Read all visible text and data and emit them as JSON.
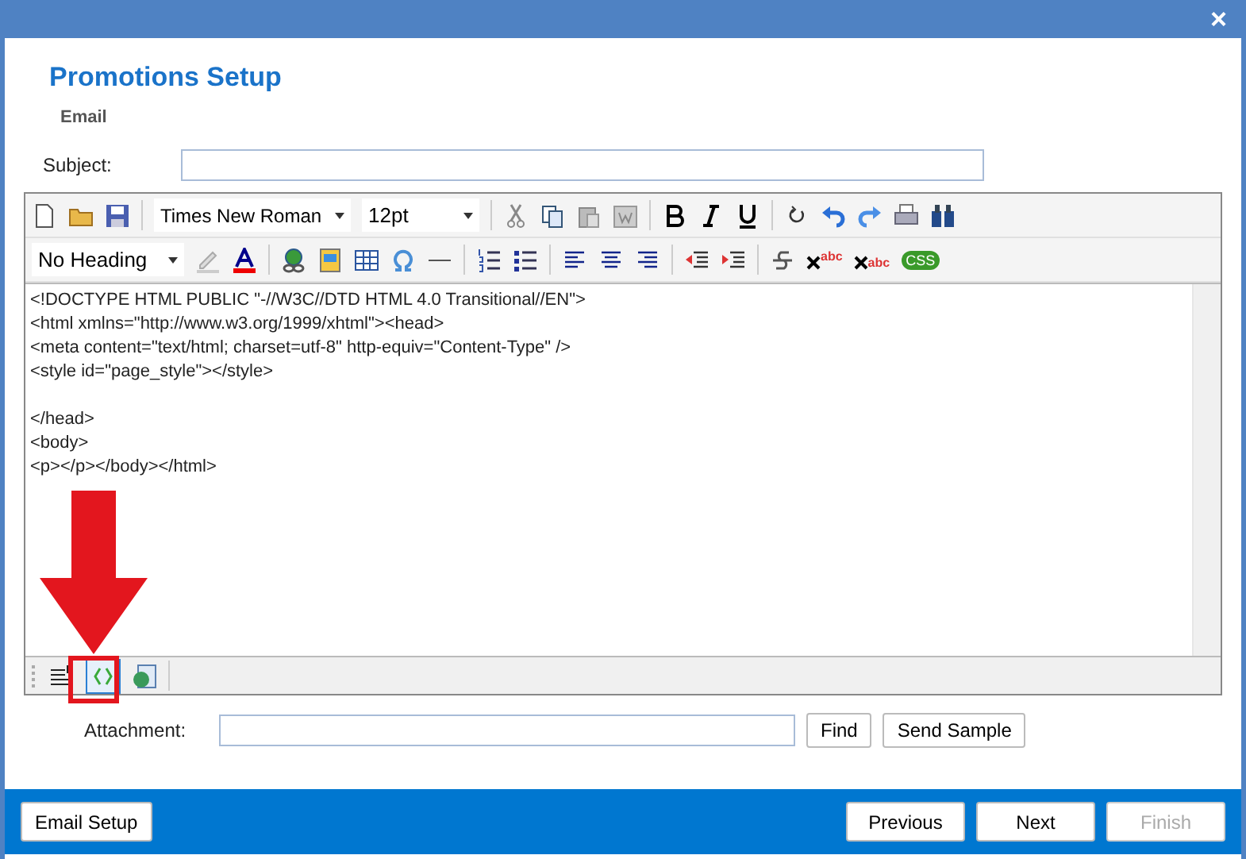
{
  "window": {
    "close": "×"
  },
  "header": {
    "title": "Promotions Setup",
    "subtitle": "Email"
  },
  "subject": {
    "label": "Subject:"
  },
  "editor": {
    "toolbar_1": {
      "font": "Times New Roman",
      "size": "12pt"
    },
    "toolbar_2": {
      "heading": "No Heading",
      "superscript_text": "abc",
      "subscript_text": "abc",
      "css_badge": "CSS"
    },
    "code_blocks": [
      [
        "<!DOCTYPE HTML PUBLIC \"-//W3C//DTD HTML 4.0 Transitional//EN\">",
        "<html xmlns=\"http://www.w3.org/1999/xhtml\"><head>",
        "<meta content=\"text/html; charset=utf-8\" http-equiv=\"Content-Type\" />",
        "<style id=\"page_style\"></style>"
      ],
      [
        "</head>",
        "<body>",
        "<p></p></body></html>"
      ]
    ],
    "view_modes": [
      {
        "selected": false
      },
      {
        "selected": true
      },
      {
        "selected": false
      }
    ],
    "highlight_arrow": true
  },
  "attachment": {
    "label": "Attachment:",
    "find": "Find",
    "send_sample": "Send Sample"
  },
  "footer": {
    "buttons": [
      {
        "label": "Email Setup",
        "kind": "left",
        "disabled": false
      },
      {
        "label": "Previous",
        "kind": "right",
        "disabled": false
      },
      {
        "label": "Next",
        "kind": "right",
        "disabled": false
      },
      {
        "label": "Finish",
        "kind": "right",
        "disabled": true
      }
    ]
  }
}
